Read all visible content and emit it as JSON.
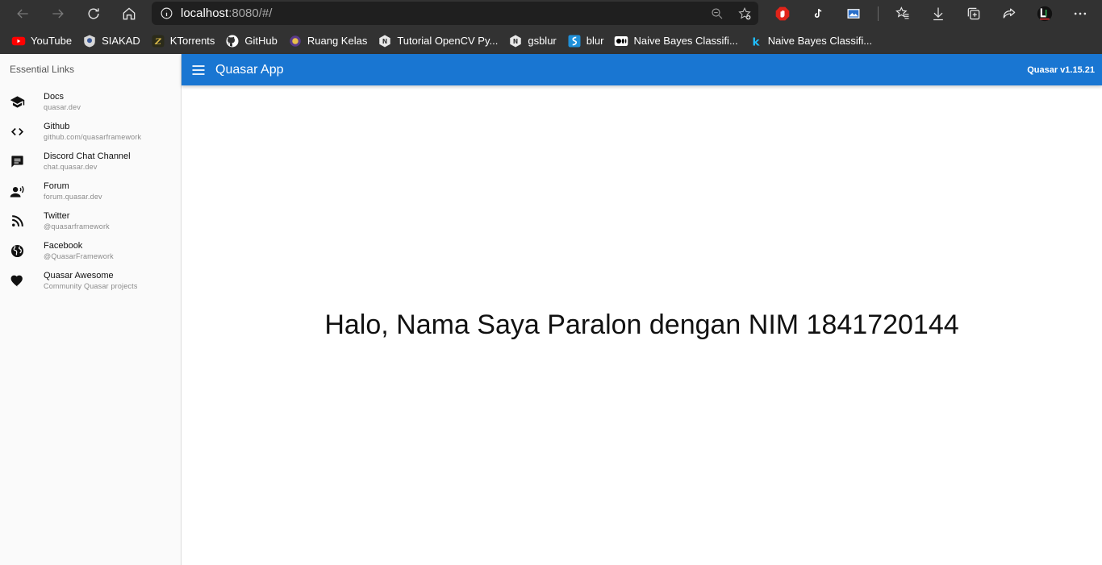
{
  "browser": {
    "nav": {
      "back_icon": "back-arrow-icon",
      "forward_icon": "forward-arrow-icon",
      "reload_icon": "reload-icon",
      "home_icon": "home-icon"
    },
    "address": {
      "host": "localhost",
      "rest": ":8080/#/"
    },
    "bookmarks": [
      {
        "label": "YouTube",
        "icon": "youtube-icon",
        "color": "#ff0000"
      },
      {
        "label": "SIAKAD",
        "icon": "siakad-icon",
        "color": "#3b5998"
      },
      {
        "label": "KTorrents",
        "icon": "ktorrents-icon",
        "color": "#b8a040"
      },
      {
        "label": "GitHub",
        "icon": "github-icon",
        "color": "#ffffff"
      },
      {
        "label": "Ruang Kelas",
        "icon": "ruang-kelas-icon",
        "color": "#7a4fb0"
      },
      {
        "label": "Tutorial OpenCV Py...",
        "icon": "opencv-icon",
        "color": "#e8e8e8"
      },
      {
        "label": "gsblur",
        "icon": "gsblur-icon",
        "color": "#e8e8e8"
      },
      {
        "label": "blur",
        "icon": "blur-icon",
        "color": "#1f8fd8"
      },
      {
        "label": "Naive Bayes Classifi...",
        "icon": "medium-icon",
        "color": "#000000"
      },
      {
        "label": "Naive Bayes Classifi...",
        "icon": "kaggle-icon",
        "color": "#20beff"
      }
    ]
  },
  "drawer": {
    "header": "Essential Links",
    "links": [
      {
        "title": "Docs",
        "caption": "quasar.dev",
        "icon": "school-icon"
      },
      {
        "title": "Github",
        "caption": "github.com/quasarframework",
        "icon": "code-icon"
      },
      {
        "title": "Discord Chat Channel",
        "caption": "chat.quasar.dev",
        "icon": "chat-icon"
      },
      {
        "title": "Forum",
        "caption": "forum.quasar.dev",
        "icon": "record-voice-icon"
      },
      {
        "title": "Twitter",
        "caption": "@quasarframework",
        "icon": "rss-feed-icon"
      },
      {
        "title": "Facebook",
        "caption": "@QuasarFramework",
        "icon": "public-icon"
      },
      {
        "title": "Quasar Awesome",
        "caption": "Community Quasar projects",
        "icon": "favorite-icon"
      }
    ]
  },
  "header": {
    "title": "Quasar App",
    "version": "Quasar v1.15.21",
    "color": "#1976d2"
  },
  "main": {
    "greeting": "Halo, Nama Saya Paralon dengan NIM 1841720144"
  }
}
